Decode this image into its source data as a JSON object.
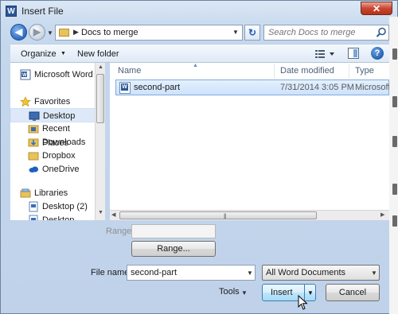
{
  "window": {
    "title": "Insert File",
    "app_icon_letter": "W",
    "close_glyph": "✕"
  },
  "navigation": {
    "back_glyph": "◀",
    "forward_glyph": "▶",
    "address_separator": "▶",
    "address_path": "Docs to merge",
    "refresh_glyph": "↻",
    "search_placeholder": "Search Docs to merge"
  },
  "toolbar": {
    "organize_label": "Organize",
    "new_folder_label": "New folder",
    "help_glyph": "?"
  },
  "nav_pane": {
    "items": [
      {
        "label": "Microsoft Word",
        "icon": "word-doc-icon"
      },
      {
        "label": "Favorites",
        "icon": "star-icon"
      },
      {
        "label": "Desktop",
        "icon": "desktop-icon",
        "selected": true
      },
      {
        "label": "Recent Places",
        "icon": "recent-places-icon"
      },
      {
        "label": "Downloads",
        "icon": "downloads-icon"
      },
      {
        "label": "Dropbox",
        "icon": "dropbox-icon"
      },
      {
        "label": "OneDrive",
        "icon": "onedrive-icon"
      },
      {
        "label": "Libraries",
        "icon": "libraries-icon"
      },
      {
        "label": "Desktop (2)",
        "icon": "desktop-icon"
      },
      {
        "label": "Desktop",
        "icon": "desktop-icon"
      }
    ]
  },
  "file_list": {
    "columns": [
      "Name",
      "Date modified",
      "Type"
    ],
    "rows": [
      {
        "name": "second-part",
        "date_modified": "7/31/2014 3:05 PM",
        "type": "Microsoft",
        "selected": true
      }
    ]
  },
  "range": {
    "label": "Range:",
    "button_label": "Range..."
  },
  "file_name": {
    "label": "File name:",
    "value": "second-part"
  },
  "file_type_filter": {
    "selected": "All Word Documents"
  },
  "actions": {
    "tools_label": "Tools",
    "insert_label": "Insert",
    "cancel_label": "Cancel"
  },
  "colors": {
    "accent": "#3c7fb1",
    "selection": "#cde2fb",
    "close": "#c9462f"
  }
}
